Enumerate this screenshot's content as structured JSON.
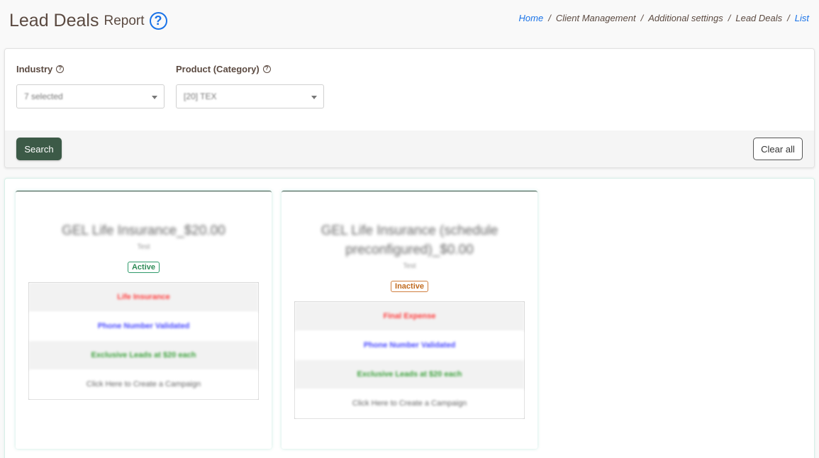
{
  "header": {
    "title": "Lead Deals",
    "subtitle": "Report",
    "help_icon": "question-circle-icon"
  },
  "breadcrumb": {
    "items": [
      "Home",
      "Client Management",
      "Additional settings",
      "Lead Deals",
      "List"
    ]
  },
  "filters": {
    "industry": {
      "label": "Industry",
      "value": "7 selected"
    },
    "product": {
      "label": "Product (Category)",
      "value": "[20] TEX"
    },
    "search_label": "Search",
    "clear_label": "Clear all"
  },
  "cards": [
    {
      "title": "GEL Life Insurance_$20.00",
      "subtitle": "Test",
      "status": "Active",
      "rows": [
        "Life Insurance",
        "Phone Number Validated",
        "Exclusive Leads at $20 each",
        "Click Here to Create a Campaign"
      ]
    },
    {
      "title": "GEL Life Insurance (schedule preconfigured)_$0.00",
      "subtitle": "Test",
      "status": "Inactive",
      "rows": [
        "Final Expense",
        "Phone Number Validated",
        "Exclusive Leads at $20 each",
        "Click Here to Create a Campaign"
      ]
    }
  ],
  "colors": {
    "primary_button": "#3c5a47",
    "link": "#1a73e8",
    "active": "#2e8b57",
    "inactive": "#c06a1e"
  }
}
